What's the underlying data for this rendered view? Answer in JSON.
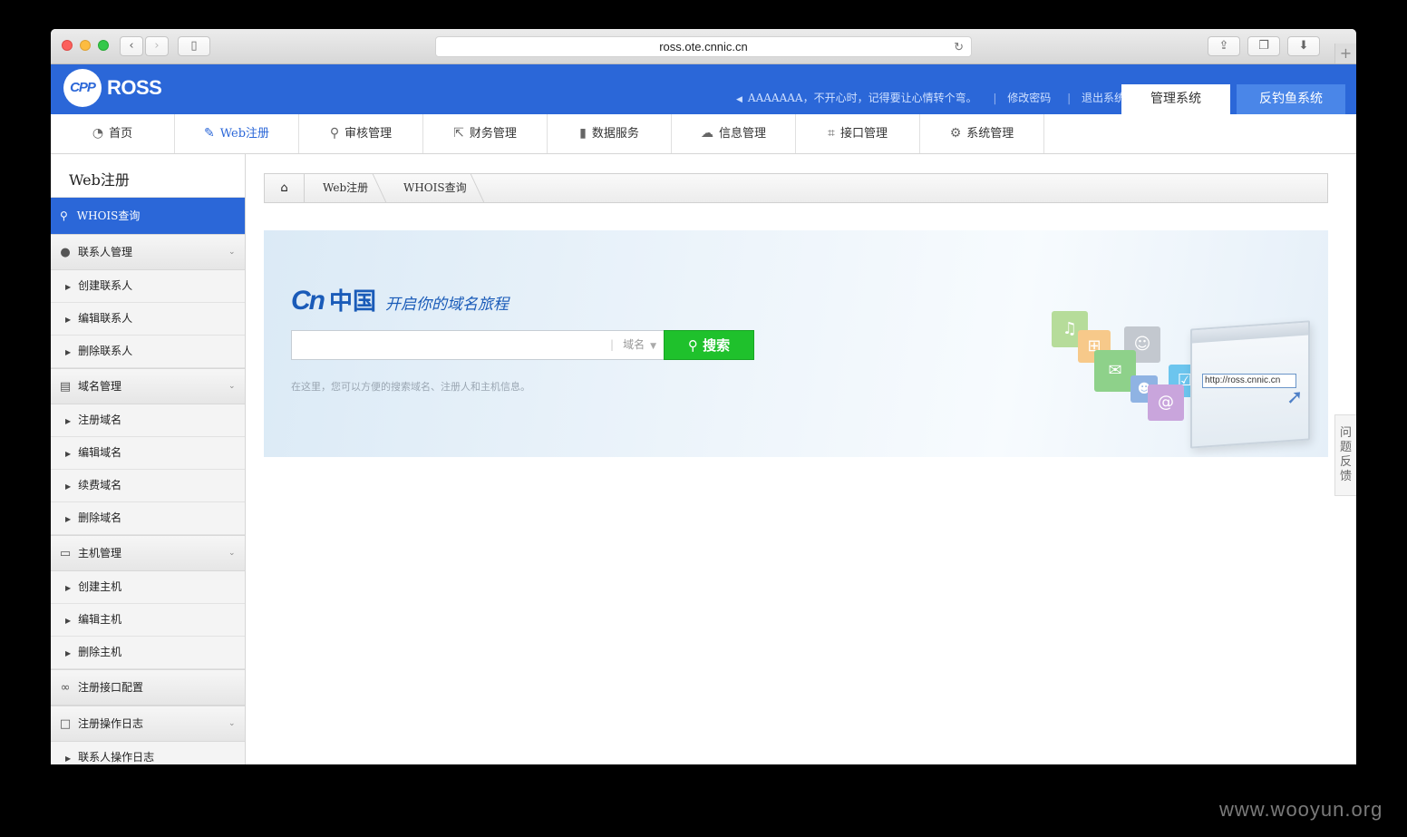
{
  "browser": {
    "url": "ross.ote.cnnic.cn"
  },
  "header": {
    "logo_badge": "CPP",
    "logo_text": "ROSS",
    "greeting": "AAAAAAA，不开心时，记得要让心情转个弯。",
    "change_password": "修改密码",
    "logout": "退出系统",
    "tabs": [
      "管理系统",
      "反钓鱼系统"
    ]
  },
  "mainnav": [
    {
      "label": "首页",
      "icon": "home-icon",
      "active": false
    },
    {
      "label": "Web注册",
      "icon": "edit-icon",
      "active": true
    },
    {
      "label": "审核管理",
      "icon": "search-icon",
      "active": false
    },
    {
      "label": "财务管理",
      "icon": "export-icon",
      "active": false
    },
    {
      "label": "数据服务",
      "icon": "bar-chart-icon",
      "active": false
    },
    {
      "label": "信息管理",
      "icon": "chat-icon",
      "active": false
    },
    {
      "label": "接口管理",
      "icon": "crop-icon",
      "active": false
    },
    {
      "label": "系统管理",
      "icon": "gears-icon",
      "active": false
    }
  ],
  "sidebar": {
    "title": "Web注册",
    "active_item": "WHOIS查询",
    "groups": [
      {
        "label": "联系人管理",
        "icon": "user-icon",
        "items": [
          "创建联系人",
          "编辑联系人",
          "删除联系人"
        ]
      },
      {
        "label": "域名管理",
        "icon": "list-icon",
        "items": [
          "注册域名",
          "编辑域名",
          "续费域名",
          "删除域名"
        ]
      },
      {
        "label": "主机管理",
        "icon": "monitor-icon",
        "items": [
          "创建主机",
          "编辑主机",
          "删除主机"
        ]
      },
      {
        "label": "注册接口配置",
        "icon": "link-icon",
        "items": []
      },
      {
        "label": "注册操作日志",
        "icon": "square-icon",
        "items": [
          "联系人操作日志"
        ]
      }
    ]
  },
  "breadcrumb": [
    "Web注册",
    "WHOIS查询"
  ],
  "banner": {
    "logo_cn": "Cn",
    "logo_zg": "中国",
    "slogan": "开启你的域名旅程",
    "search_placeholder": "",
    "search_type": "域名",
    "search_button": "搜索",
    "hint": "在这里，您可以方便的搜索域名、注册人和主机信息。",
    "art_url": "http://ross.cnnic.cn"
  },
  "feedback": "问题反馈",
  "watermark": "www.wooyun.org",
  "colors": {
    "brand_blue": "#2b67d8",
    "search_green": "#1fc12c"
  }
}
